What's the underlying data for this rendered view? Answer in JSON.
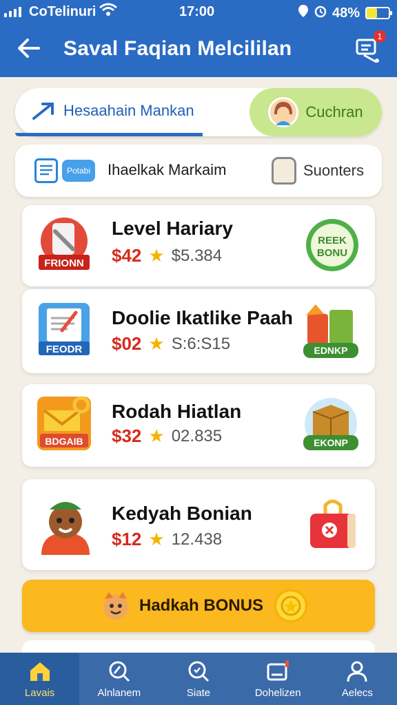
{
  "status_bar": {
    "carrier": "CoTelinuri",
    "time": "17:00",
    "battery": "48%",
    "battery_level": 0.48
  },
  "header": {
    "title": "Saval Faqian Melcililan",
    "notification_count": "1"
  },
  "tabs": {
    "left_label": "Hesaahain Mankan",
    "right_label": "Cuchran"
  },
  "filter": {
    "pill_text": "Potabi",
    "label": "Ihaelkak Markaim",
    "sort_label": "Suonters"
  },
  "cards": [
    {
      "title": "Level Hariary",
      "price": "$42",
      "old_price": "$5.384",
      "art_label": "FRIONN",
      "badge_label": "REEK BONU"
    },
    {
      "title": "Doolie Ikatlike Paah",
      "price": "$02",
      "old_price": "S:6:S15",
      "art_label": "FEODR",
      "badge_label": "EDNKP"
    },
    {
      "title": "Rodah Hiatlan",
      "price": "$32",
      "old_price": "02.835",
      "art_label": "BDGAIB",
      "badge_label": "EKONP"
    },
    {
      "title": "Kedyah Bonian",
      "price": "$12",
      "old_price": "12.438",
      "art_label": "",
      "badge_label": ""
    }
  ],
  "bonus": {
    "label": "Hadkah BONUS"
  },
  "bottom_nav": [
    {
      "label": "Lavais",
      "icon": "home-icon",
      "active": true
    },
    {
      "label": "Alnlanem",
      "icon": "explore-icon",
      "active": false
    },
    {
      "label": "Siate",
      "icon": "search-icon",
      "active": false
    },
    {
      "label": "Dohelizen",
      "icon": "inbox-icon",
      "active": false
    },
    {
      "label": "Aelecs",
      "icon": "profile-icon",
      "active": false
    }
  ],
  "colors": {
    "header": "#2a6bc4",
    "accent_green": "#c9e78e",
    "price_red": "#d72a1d",
    "bonus_yellow": "#fbb81f",
    "nav_bg": "#3b6aa9"
  }
}
